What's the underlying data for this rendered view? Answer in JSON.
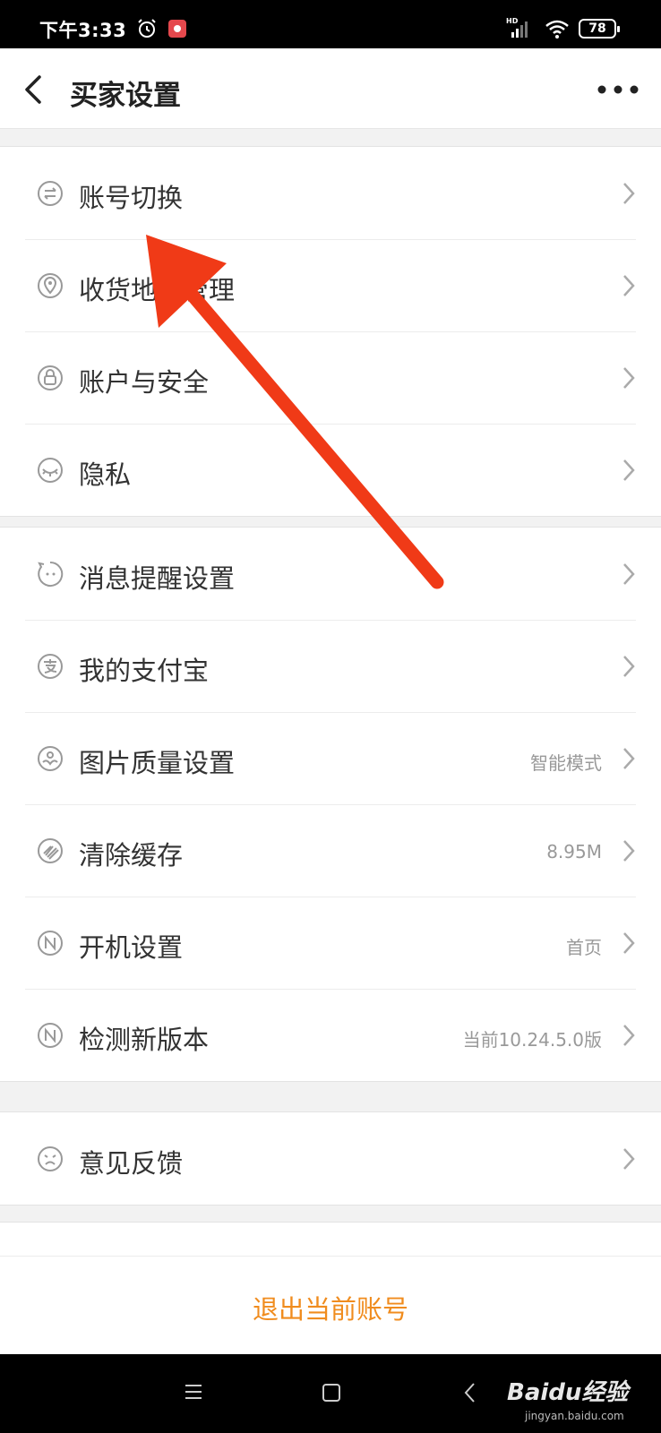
{
  "status_bar": {
    "time": "下午3:33",
    "battery": "78",
    "icons": [
      "alarm-icon",
      "app-notification-icon",
      "hd-signal-icon",
      "wifi-icon",
      "battery-icon"
    ]
  },
  "header": {
    "title": "买家设置",
    "back_icon": "chevron-left-icon",
    "more_icon": "more-dots-icon"
  },
  "groups": [
    {
      "items": [
        {
          "label": "账号切换",
          "value": "",
          "icon": "switch-account-icon"
        },
        {
          "label": "收货地址管理",
          "value": "",
          "icon": "location-pin-icon"
        },
        {
          "label": "账户与安全",
          "value": "",
          "icon": "lock-icon"
        },
        {
          "label": "隐私",
          "value": "",
          "icon": "eye-closed-icon"
        }
      ]
    },
    {
      "items": [
        {
          "label": "消息提醒设置",
          "value": "",
          "icon": "message-bubble-icon"
        },
        {
          "label": "我的支付宝",
          "value": "",
          "icon": "alipay-icon"
        },
        {
          "label": "图片质量设置",
          "value": "智能模式",
          "icon": "image-quality-icon"
        },
        {
          "label": "清除缓存",
          "value": "8.95M",
          "icon": "broom-icon"
        },
        {
          "label": "开机设置",
          "value": "首页",
          "icon": "startup-n-icon"
        },
        {
          "label": "检测新版本",
          "value": "当前10.24.5.0版",
          "icon": "version-n-icon"
        }
      ]
    },
    {
      "items": [
        {
          "label": "意见反馈",
          "value": "",
          "icon": "feedback-face-icon"
        }
      ]
    }
  ],
  "logout": {
    "label": "退出当前账号"
  },
  "nav_bar": {
    "icons": [
      "menu-icon",
      "home-square-icon",
      "back-triangle-icon"
    ],
    "watermark": "Baidu经验",
    "watermark_url": "jingyan.baidu.com"
  },
  "colors": {
    "accent": "#f08c1e",
    "annotation_arrow": "#f03a17",
    "background": "#f2f2f2"
  }
}
